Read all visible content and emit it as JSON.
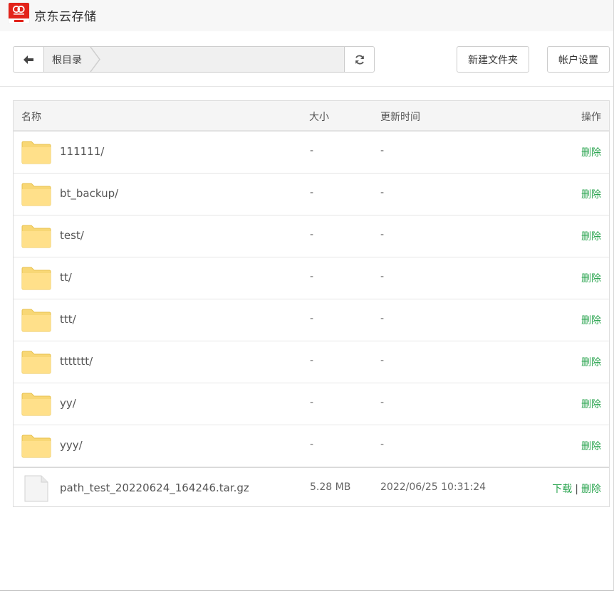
{
  "app": {
    "title": "京东云存储"
  },
  "toolbar": {
    "breadcrumb": [
      "根目录"
    ],
    "new_folder_label": "新建文件夹",
    "account_settings_label": "帐户设置"
  },
  "table": {
    "headers": {
      "name": "名称",
      "size": "大小",
      "time": "更新时间",
      "action": "操作"
    },
    "rows": [
      {
        "type": "folder",
        "name": "111111/",
        "size": "-",
        "time": "-",
        "actions": [
          "删除"
        ]
      },
      {
        "type": "folder",
        "name": "bt_backup/",
        "size": "-",
        "time": "-",
        "actions": [
          "删除"
        ]
      },
      {
        "type": "folder",
        "name": "test/",
        "size": "-",
        "time": "-",
        "actions": [
          "删除"
        ]
      },
      {
        "type": "folder",
        "name": "tt/",
        "size": "-",
        "time": "-",
        "actions": [
          "删除"
        ]
      },
      {
        "type": "folder",
        "name": "ttt/",
        "size": "-",
        "time": "-",
        "actions": [
          "删除"
        ]
      },
      {
        "type": "folder",
        "name": "ttttttt/",
        "size": "-",
        "time": "-",
        "actions": [
          "删除"
        ]
      },
      {
        "type": "folder",
        "name": "yy/",
        "size": "-",
        "time": "-",
        "actions": [
          "删除"
        ]
      },
      {
        "type": "folder",
        "name": "yyy/",
        "size": "-",
        "time": "-",
        "actions": [
          "删除"
        ]
      },
      {
        "type": "file",
        "name": "path_test_20220624_164246.tar.gz",
        "size": "5.28 MB",
        "time": "2022/06/25 10:31:24",
        "actions": [
          "下载",
          "删除"
        ]
      }
    ]
  },
  "colors": {
    "brand": "#e2231a",
    "action_link": "#2aa44f",
    "folder": "#ffe08a"
  },
  "icons": {
    "back": "arrow-left-icon",
    "refresh": "refresh-icon",
    "folder": "folder-icon",
    "file": "file-icon",
    "logo": "jd-cloud-logo-icon"
  }
}
